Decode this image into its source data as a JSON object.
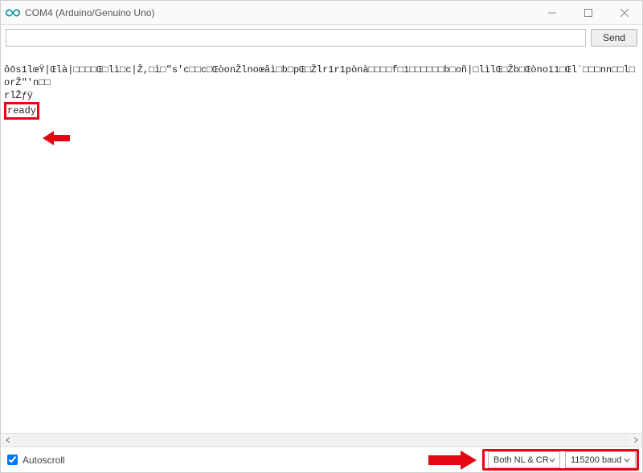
{
  "titlebar": {
    "title": "COM4 (Arduino/Genuino Uno)"
  },
  "sendrow": {
    "input_value": "",
    "input_placeholder": "",
    "send_label": "Send"
  },
  "output": {
    "line1": "ôōs1lœŸ|Œlà|□□□□Œ□lì□c|Ž,□ì□\"s'c□□c□ŒòonŽlnoœâì□b□pŒ□Žlr1r1pònà□□□□f□1□□□□□□b□oñ|□lìlŒ□Žb□Œònoï1□Œl`□□□nn□□l□orŽ\"'n□□",
    "line2": "rlŽƒÿ",
    "line3": "ready"
  },
  "bottom": {
    "autoscroll_label": "Autoscroll",
    "autoscroll_checked": true,
    "line_ending": "Both NL & CR",
    "baud": "115200 baud"
  }
}
